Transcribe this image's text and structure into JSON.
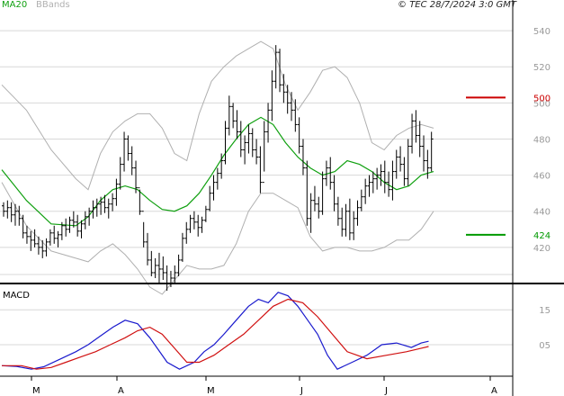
{
  "header": {
    "ma_label": "MA20",
    "bbands_label": "BBands",
    "copyright": "© TEC 28/7/2024 3:0 GMT"
  },
  "macd_panel": {
    "label": "MACD"
  },
  "colors": {
    "price_bars": "#000000",
    "ma20": "#10a010",
    "bbands": "#b0b0b0",
    "macd": "#1a1acd",
    "signal": "#d01010",
    "resistance": "#cc0000",
    "support": "#009900",
    "grid": "#d8d8d8"
  },
  "chart_data": [
    {
      "type": "ohlc",
      "ylim": [
        400,
        550
      ],
      "yticks": [
        420,
        440,
        460,
        480,
        500,
        520,
        540
      ],
      "grid": true,
      "xtick_labels": [
        "M",
        "A",
        "M",
        "J",
        "J",
        "A"
      ],
      "x_count": 130,
      "xtick_index": [
        8,
        32,
        57,
        83,
        107,
        136
      ],
      "ohlc": [
        [
          443,
          445,
          437,
          440
        ],
        [
          440,
          446,
          436,
          442
        ],
        [
          442,
          445,
          434,
          438
        ],
        [
          438,
          444,
          432,
          440
        ],
        [
          440,
          443,
          432,
          436
        ],
        [
          436,
          438,
          425,
          428
        ],
        [
          428,
          432,
          422,
          426
        ],
        [
          426,
          429,
          418,
          424
        ],
        [
          424,
          430,
          420,
          422
        ],
        [
          422,
          426,
          416,
          420
        ],
        [
          420,
          424,
          414,
          418
        ],
        [
          418,
          425,
          415,
          423
        ],
        [
          423,
          430,
          421,
          428
        ],
        [
          428,
          432,
          422,
          425
        ],
        [
          425,
          429,
          420,
          427
        ],
        [
          427,
          434,
          424,
          432
        ],
        [
          432,
          436,
          426,
          430
        ],
        [
          430,
          437,
          428,
          435
        ],
        [
          435,
          440,
          431,
          434
        ],
        [
          434,
          438,
          426,
          429
        ],
        [
          429,
          435,
          425,
          433
        ],
        [
          433,
          440,
          430,
          437
        ],
        [
          437,
          442,
          432,
          440
        ],
        [
          440,
          446,
          436,
          442
        ],
        [
          442,
          447,
          437,
          444
        ],
        [
          444,
          448,
          438,
          445
        ],
        [
          445,
          449,
          439,
          442
        ],
        [
          442,
          447,
          436,
          444
        ],
        [
          444,
          450,
          440,
          447
        ],
        [
          447,
          458,
          443,
          455
        ],
        [
          455,
          470,
          452,
          466
        ],
        [
          466,
          484,
          462,
          480
        ],
        [
          480,
          482,
          468,
          472
        ],
        [
          472,
          476,
          460,
          464
        ],
        [
          464,
          468,
          450,
          453
        ],
        [
          453,
          452,
          438,
          440
        ],
        [
          440,
          434,
          420,
          423
        ],
        [
          423,
          428,
          410,
          413
        ],
        [
          413,
          418,
          404,
          406
        ],
        [
          406,
          414,
          403,
          410
        ],
        [
          410,
          417,
          400,
          408
        ],
        [
          408,
          415,
          402,
          406
        ],
        [
          406,
          410,
          396,
          400
        ],
        [
          400,
          407,
          398,
          403
        ],
        [
          403,
          410,
          400,
          406
        ],
        [
          406,
          416,
          404,
          413
        ],
        [
          413,
          428,
          412,
          425
        ],
        [
          425,
          434,
          422,
          430
        ],
        [
          430,
          438,
          428,
          436
        ],
        [
          436,
          440,
          430,
          434
        ],
        [
          434,
          438,
          426,
          431
        ],
        [
          431,
          437,
          428,
          435
        ],
        [
          435,
          443,
          434,
          441
        ],
        [
          441,
          454,
          440,
          450
        ],
        [
          450,
          460,
          446,
          456
        ],
        [
          456,
          464,
          452,
          461
        ],
        [
          461,
          472,
          458,
          468
        ],
        [
          468,
          490,
          466,
          486
        ],
        [
          486,
          504,
          482,
          498
        ],
        [
          498,
          500,
          486,
          490
        ],
        [
          490,
          496,
          480,
          484
        ],
        [
          484,
          490,
          470,
          474
        ],
        [
          474,
          482,
          466,
          478
        ],
        [
          478,
          488,
          472,
          483
        ],
        [
          483,
          486,
          470,
          474
        ],
        [
          474,
          480,
          466,
          470
        ],
        [
          470,
          476,
          450,
          456
        ],
        [
          456,
          490,
          462,
          484
        ],
        [
          484,
          500,
          478,
          496
        ],
        [
          496,
          518,
          490,
          512
        ],
        [
          512,
          532,
          508,
          528
        ],
        [
          528,
          530,
          506,
          510
        ],
        [
          510,
          516,
          500,
          506
        ],
        [
          506,
          510,
          494,
          500
        ],
        [
          500,
          506,
          490,
          496
        ],
        [
          496,
          502,
          484,
          488
        ],
        [
          488,
          492,
          472,
          476
        ],
        [
          476,
          480,
          460,
          464
        ],
        [
          464,
          468,
          432,
          436
        ],
        [
          436,
          450,
          428,
          446
        ],
        [
          446,
          454,
          440,
          444
        ],
        [
          444,
          448,
          436,
          440
        ],
        [
          440,
          462,
          438,
          458
        ],
        [
          458,
          468,
          454,
          464
        ],
        [
          464,
          470,
          452,
          456
        ],
        [
          456,
          460,
          440,
          444
        ],
        [
          444,
          448,
          432,
          436
        ],
        [
          436,
          442,
          426,
          430
        ],
        [
          430,
          444,
          426,
          440
        ],
        [
          440,
          447,
          424,
          428
        ],
        [
          428,
          440,
          424,
          436
        ],
        [
          436,
          446,
          432,
          442
        ],
        [
          442,
          452,
          440,
          448
        ],
        [
          448,
          458,
          444,
          454
        ],
        [
          454,
          460,
          448,
          456
        ],
        [
          456,
          462,
          450,
          458
        ],
        [
          458,
          464,
          452,
          460
        ],
        [
          460,
          466,
          454,
          462
        ],
        [
          462,
          468,
          450,
          456
        ],
        [
          456,
          462,
          448,
          452
        ],
        [
          452,
          468,
          446,
          462
        ],
        [
          462,
          474,
          458,
          470
        ],
        [
          470,
          476,
          462,
          466
        ],
        [
          466,
          470,
          454,
          458
        ],
        [
          458,
          480,
          454,
          476
        ],
        [
          476,
          494,
          472,
          490
        ],
        [
          490,
          496,
          478,
          482
        ],
        [
          482,
          490,
          470,
          476
        ],
        [
          476,
          482,
          462,
          468
        ],
        [
          468,
          474,
          458,
          464
        ],
        [
          464,
          484,
          462,
          480
        ]
      ],
      "ma20": [
        [
          0,
          463
        ],
        [
          10,
          446
        ],
        [
          20,
          433
        ],
        [
          30,
          432
        ],
        [
          35,
          437
        ],
        [
          40,
          446
        ],
        [
          45,
          452
        ],
        [
          50,
          454
        ],
        [
          55,
          452
        ],
        [
          60,
          446
        ],
        [
          65,
          441
        ],
        [
          70,
          440
        ],
        [
          75,
          443
        ],
        [
          80,
          450
        ],
        [
          85,
          460
        ],
        [
          90,
          471
        ],
        [
          95,
          480
        ],
        [
          100,
          488
        ],
        [
          105,
          492
        ],
        [
          110,
          488
        ],
        [
          115,
          478
        ],
        [
          120,
          470
        ],
        [
          125,
          464
        ],
        [
          130,
          460
        ],
        [
          135,
          462
        ],
        [
          140,
          468
        ],
        [
          145,
          466
        ],
        [
          150,
          462
        ],
        [
          155,
          456
        ],
        [
          160,
          452
        ],
        [
          165,
          454
        ],
        [
          170,
          460
        ],
        [
          175,
          462
        ]
      ],
      "bb_upper": [
        [
          0,
          510
        ],
        [
          10,
          496
        ],
        [
          20,
          474
        ],
        [
          30,
          458
        ],
        [
          35,
          452
        ],
        [
          40,
          472
        ],
        [
          45,
          484
        ],
        [
          50,
          490
        ],
        [
          55,
          494
        ],
        [
          60,
          494
        ],
        [
          65,
          486
        ],
        [
          70,
          472
        ],
        [
          75,
          468
        ],
        [
          80,
          494
        ],
        [
          85,
          512
        ],
        [
          90,
          520
        ],
        [
          95,
          526
        ],
        [
          100,
          530
        ],
        [
          105,
          534
        ],
        [
          110,
          530
        ],
        [
          115,
          510
        ],
        [
          120,
          496
        ],
        [
          125,
          506
        ],
        [
          130,
          518
        ],
        [
          135,
          520
        ],
        [
          140,
          514
        ],
        [
          145,
          500
        ],
        [
          150,
          478
        ],
        [
          155,
          474
        ],
        [
          160,
          482
        ],
        [
          165,
          486
        ],
        [
          170,
          488
        ],
        [
          175,
          486
        ]
      ],
      "bb_lower": [
        [
          0,
          456
        ],
        [
          10,
          432
        ],
        [
          20,
          418
        ],
        [
          30,
          414
        ],
        [
          35,
          412
        ],
        [
          40,
          418
        ],
        [
          45,
          422
        ],
        [
          50,
          416
        ],
        [
          55,
          408
        ],
        [
          60,
          398
        ],
        [
          65,
          394
        ],
        [
          70,
          402
        ],
        [
          75,
          410
        ],
        [
          80,
          408
        ],
        [
          85,
          408
        ],
        [
          90,
          410
        ],
        [
          95,
          422
        ],
        [
          100,
          440
        ],
        [
          105,
          450
        ],
        [
          110,
          450
        ],
        [
          115,
          446
        ],
        [
          120,
          442
        ],
        [
          125,
          426
        ],
        [
          130,
          418
        ],
        [
          135,
          420
        ],
        [
          140,
          420
        ],
        [
          145,
          418
        ],
        [
          150,
          418
        ],
        [
          155,
          420
        ],
        [
          160,
          424
        ],
        [
          165,
          424
        ],
        [
          170,
          430
        ],
        [
          175,
          440
        ]
      ],
      "levels": [
        {
          "label": "500",
          "value": 503,
          "color": "#cc0000"
        },
        {
          "label": "424",
          "value": 427,
          "color": "#009900"
        }
      ]
    },
    {
      "type": "line",
      "title": "MACD",
      "ylim": [
        -4,
        22
      ],
      "yticks": [
        5,
        15
      ],
      "ytick_labels": [
        "05",
        "15"
      ],
      "series": [
        {
          "name": "MACD",
          "x": [
            0,
            6,
            12,
            17,
            24,
            30,
            35,
            40,
            45,
            50,
            55,
            60,
            63,
            67,
            72,
            78,
            82,
            86,
            90,
            95,
            100,
            104,
            108,
            112,
            116,
            120,
            124,
            128,
            132,
            136,
            142,
            148,
            154,
            160,
            166,
            170,
            173
          ],
          "values": [
            -1,
            -1.2,
            -2,
            -1.3,
            1,
            3,
            5,
            7.5,
            10,
            12,
            11,
            7,
            4,
            0,
            -2,
            0,
            3,
            5,
            8,
            12,
            16,
            18,
            17,
            20,
            19,
            16,
            12,
            8,
            2,
            -2,
            0,
            2,
            5,
            5.5,
            4.2,
            5.5,
            6
          ]
        },
        {
          "name": "Signal",
          "x": [
            0,
            8,
            14,
            20,
            26,
            32,
            38,
            44,
            50,
            55,
            60,
            65,
            70,
            75,
            80,
            86,
            92,
            98,
            104,
            110,
            116,
            122,
            128,
            134,
            140,
            148,
            156,
            164,
            170,
            173
          ],
          "values": [
            -1,
            -1,
            -2,
            -1.5,
            0,
            1.5,
            3,
            5,
            7,
            9,
            10,
            8,
            4,
            0,
            0,
            2,
            5,
            8,
            12,
            16,
            18,
            17,
            13,
            8,
            3,
            1,
            2,
            3,
            4,
            4.5
          ]
        }
      ]
    }
  ]
}
